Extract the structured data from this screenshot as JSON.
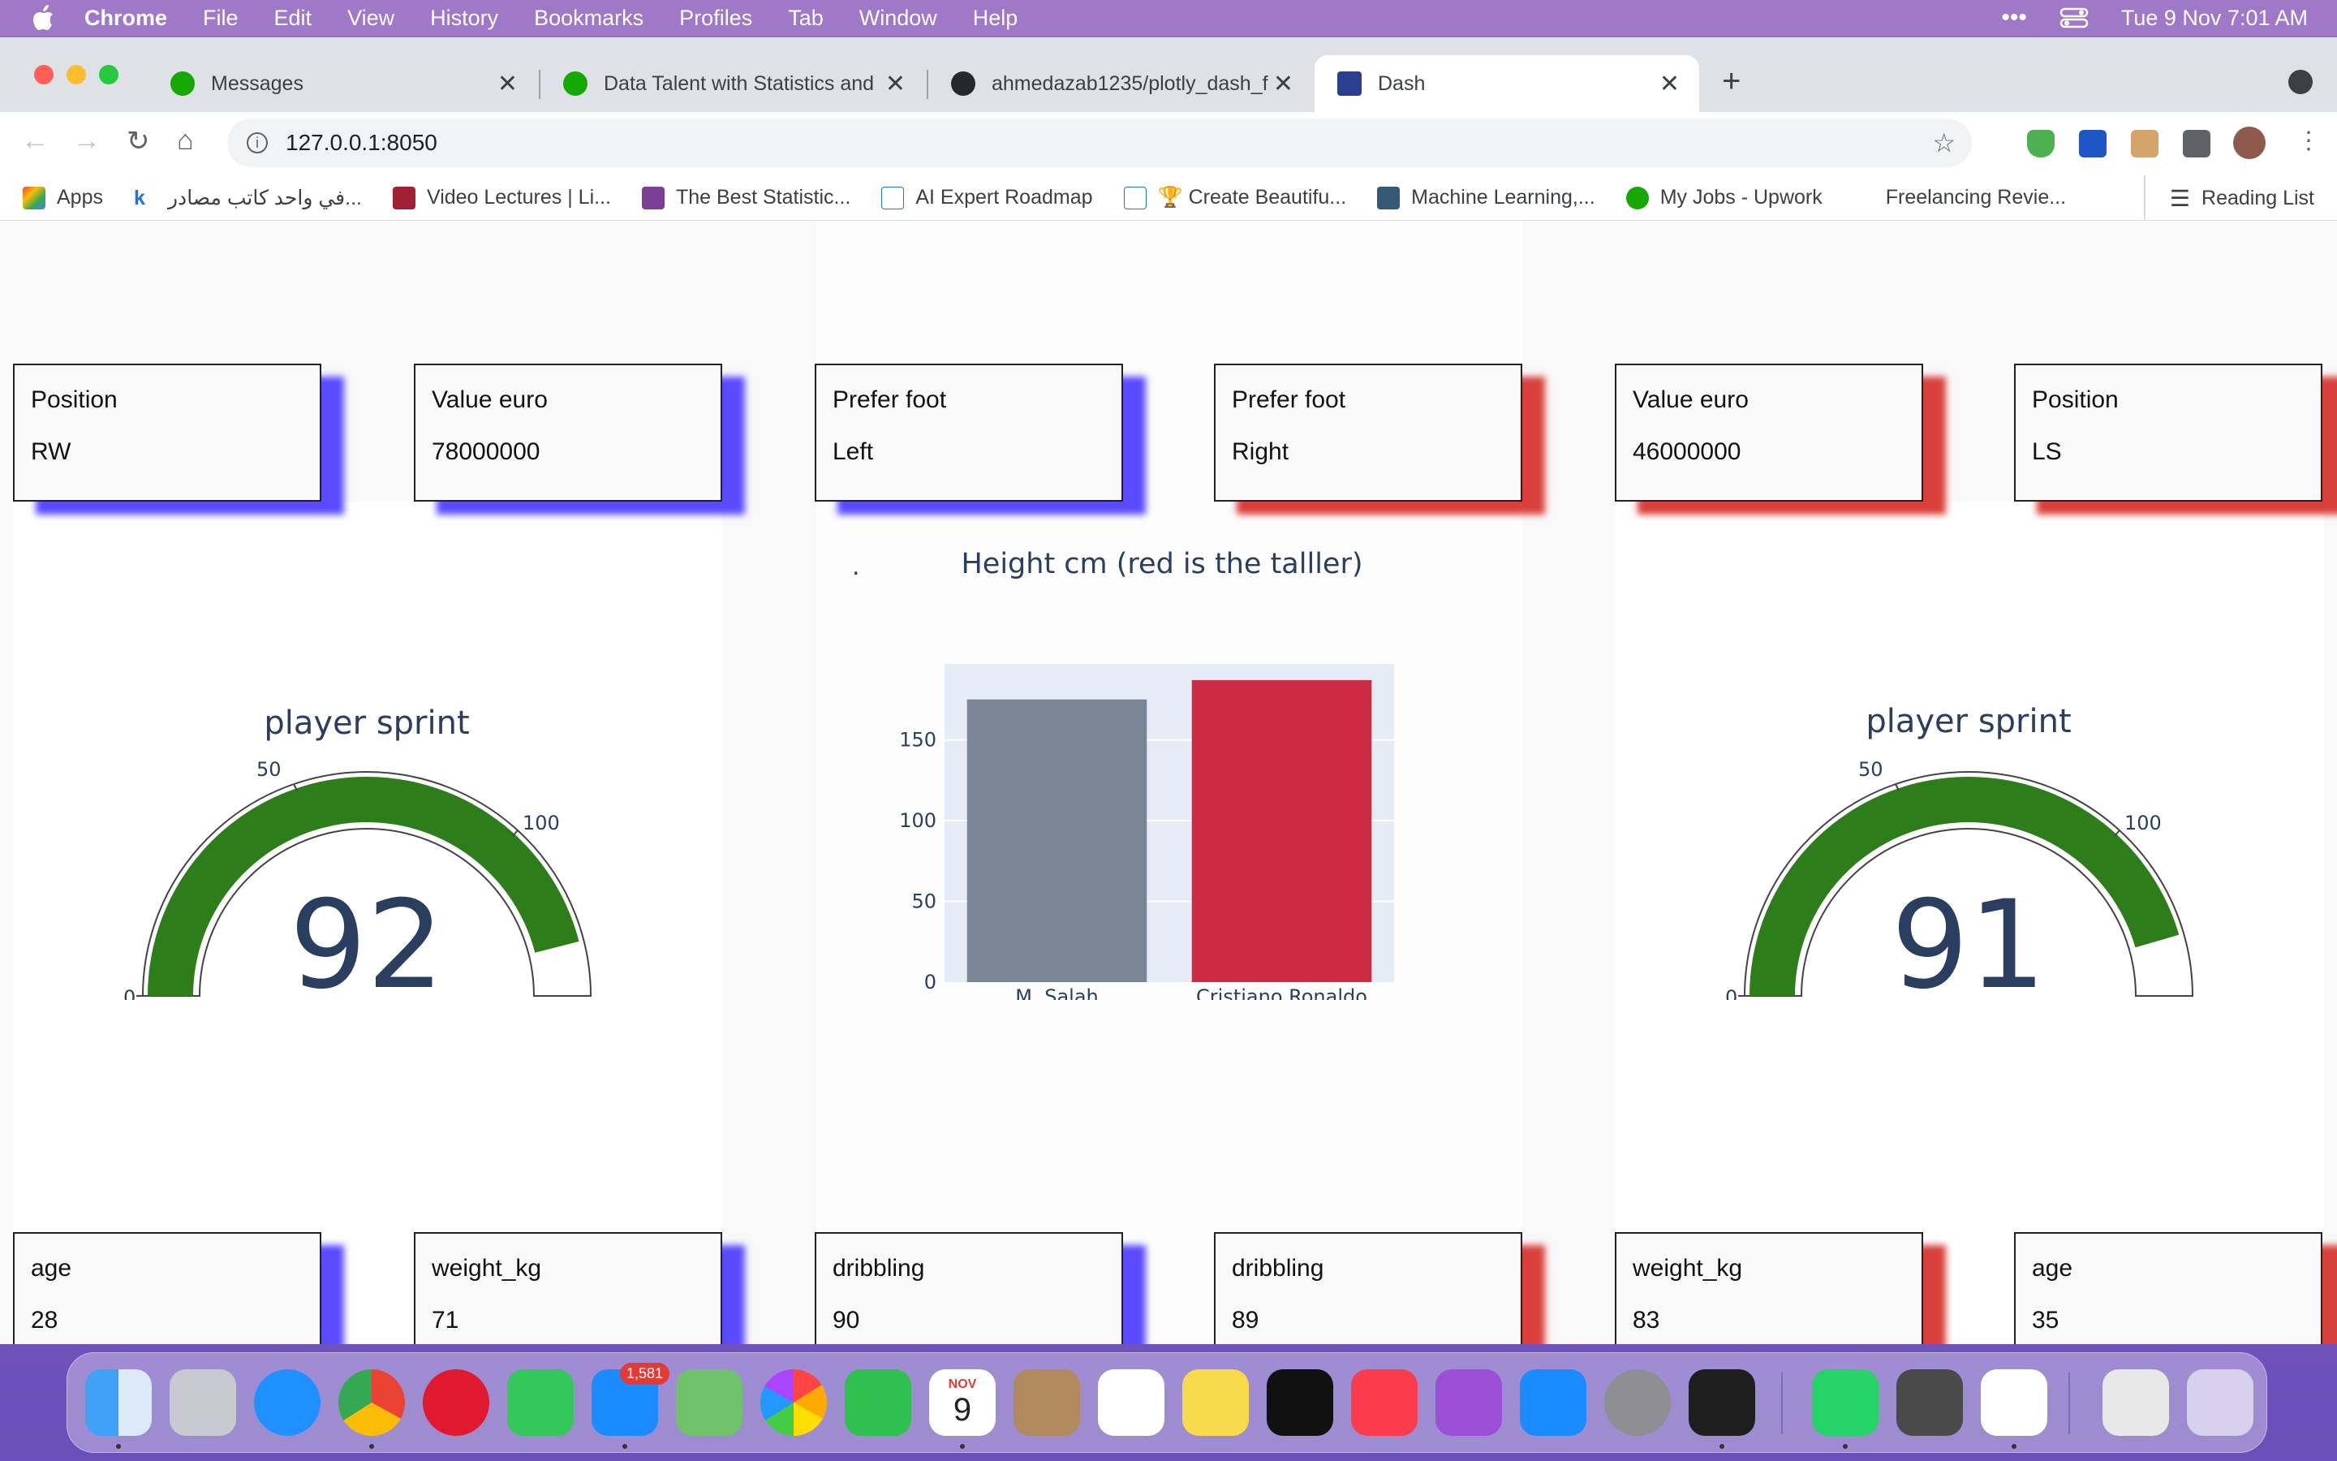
{
  "menubar": {
    "app": "Chrome",
    "items": [
      "File",
      "Edit",
      "View",
      "History",
      "Bookmarks",
      "Profiles",
      "Tab",
      "Window",
      "Help"
    ],
    "clock": "Tue 9 Nov  7:01 AM"
  },
  "tabs": [
    {
      "title": "Messages"
    },
    {
      "title": "Data Talent with Statistics and"
    },
    {
      "title": "ahmedazab1235/plotly_dash_f"
    },
    {
      "title": "Dash"
    }
  ],
  "address": {
    "url": "127.0.0.1:8050"
  },
  "bookmarks": [
    {
      "label": "Apps"
    },
    {
      "label": "في واحد كاتب مصادر..."
    },
    {
      "label": "Video Lectures | Li..."
    },
    {
      "label": "The Best Statistic..."
    },
    {
      "label": "AI Expert Roadmap"
    },
    {
      "label": "🏆 Create Beautifu..."
    },
    {
      "label": "Machine Learning,..."
    },
    {
      "label": "My Jobs - Upwork"
    },
    {
      "label": "Freelancing Revie..."
    }
  ],
  "reading_list": "Reading List",
  "left": {
    "top_cards": [
      {
        "label": "Position",
        "value": "RW"
      },
      {
        "label": "Value euro",
        "value": "78000000"
      }
    ],
    "bottom_cards": [
      {
        "label": "age",
        "value": "28"
      },
      {
        "label": "weight_kg",
        "value": "71"
      }
    ],
    "gauge": {
      "title": "player sprint",
      "value": 92,
      "min_label": "0",
      "mid_label": "50",
      "max_label": "100"
    }
  },
  "center": {
    "top_cards": [
      {
        "label": "Prefer foot",
        "value": "Left"
      },
      {
        "label": "Prefer foot",
        "value": "Right"
      }
    ],
    "bottom_cards": [
      {
        "label": "dribbling",
        "value": "90"
      },
      {
        "label": "dribbling",
        "value": "89"
      }
    ],
    "dot": "."
  },
  "right": {
    "top_cards": [
      {
        "label": "Value euro",
        "value": "46000000"
      },
      {
        "label": "Position",
        "value": "LS"
      }
    ],
    "bottom_cards": [
      {
        "label": "weight_kg",
        "value": "83"
      },
      {
        "label": "age",
        "value": "35"
      }
    ],
    "gauge": {
      "title": "player sprint",
      "value": 91,
      "min_label": "0",
      "mid_label": "50",
      "max_label": "100"
    }
  },
  "chart_data": {
    "type": "bar",
    "title": "Height cm (red is the talller)",
    "categories": [
      "M. Salah",
      "Cristiano Ronaldo"
    ],
    "values": [
      175,
      187
    ],
    "bar_colors": [
      "#7a8696",
      "#cc2b43"
    ],
    "yticks": [
      "0",
      "50",
      "100",
      "150"
    ],
    "ylim": [
      0,
      197
    ],
    "xlabel": "",
    "ylabel": "",
    "grid": true,
    "legend": "none"
  },
  "dock": {
    "mail_badge": "1,581",
    "calendar_month": "NOV",
    "calendar_day": "9",
    "apps": [
      "finder-icon",
      "launchpad-icon",
      "safari-icon",
      "chrome-icon",
      "opera-icon",
      "messages-icon",
      "mail-icon",
      "maps-icon",
      "photos-icon",
      "facetime-icon",
      "calendar-icon",
      "contacts-icon",
      "reminders-icon",
      "notes-icon",
      "tv-icon",
      "music-icon",
      "podcasts-icon",
      "appstore-icon",
      "settings-icon",
      "terminal-icon",
      "whatsapp-icon",
      "sublime-icon",
      "vscode-icon",
      "preview-icon",
      "trash-icon"
    ]
  },
  "colors": {
    "card_shadow_blue": "#5a4bff",
    "card_shadow_red": "#d9403c",
    "gauge_bar": "#2e7d1b",
    "gauge_text": "#2a3f5f",
    "plot_bg": "#e5ecf6"
  }
}
